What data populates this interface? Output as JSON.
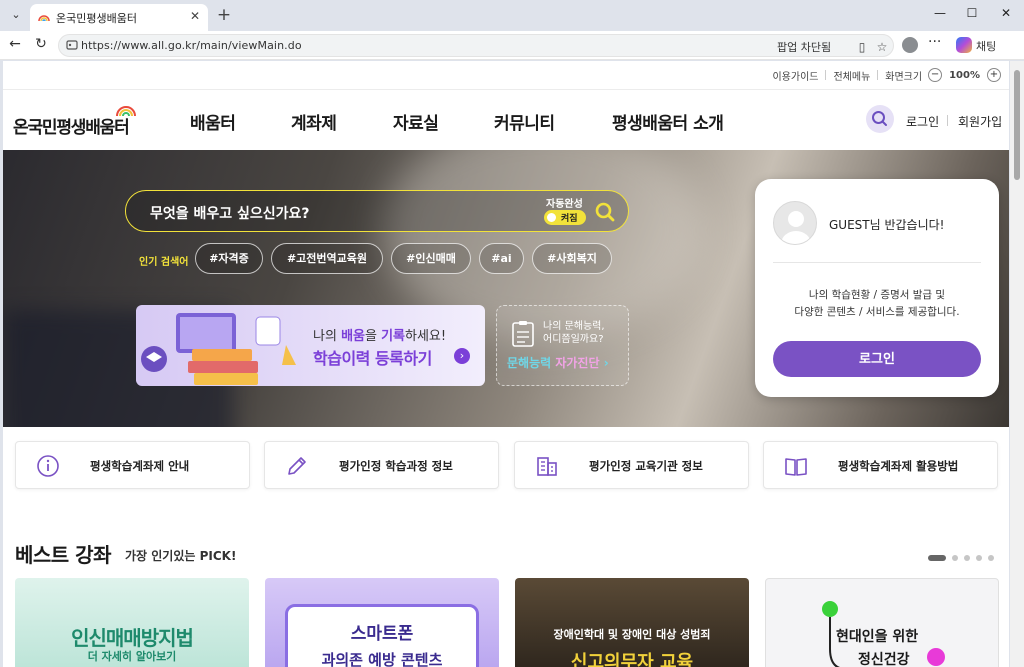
{
  "browser": {
    "tab_title": "온국민평생배움터",
    "url": "https://www.all.go.kr/main/viewMain.do",
    "popup_block": "팝업 차단됨",
    "chat_label": "채팅"
  },
  "util_menu": {
    "guide": "이용가이드",
    "all_menu": "전체메뉴",
    "screen_size": "화면크기",
    "zoom_minus": "−",
    "zoom_value": "100%",
    "zoom_plus": "+"
  },
  "header": {
    "logo": "온국민평생배움터",
    "nav": [
      "배움터",
      "계좌제",
      "자료실",
      "커뮤니티",
      "평생배움터 소개"
    ],
    "login": "로그인",
    "join": "회원가입"
  },
  "hero": {
    "search_placeholder": "무엇을 배우고 싶으신가요?",
    "auto_complete_label": "자동완성",
    "auto_complete_state": "켜짐",
    "popular_label": "인기 검색어",
    "popular_tags": [
      "#자격증",
      "#고전번역교육원",
      "#인신매매",
      "#ai",
      "#사회복지"
    ],
    "banner1_line1_pre": "나의 ",
    "banner1_line1_b1": "배움",
    "banner1_line1_mid": "을 ",
    "banner1_line1_b2": "기록",
    "banner1_line1_post": "하세요!",
    "banner1_line2": "학습이력 등록하기",
    "banner2_line1": "나의 문해능력,",
    "banner2_line2": "어디쯤일까요?",
    "banner2_line3_a": "문해능력 ",
    "banner2_line3_b": "자가진단"
  },
  "login_card": {
    "greeting": "GUEST님 반갑습니다!",
    "desc1": "나의 학습현황 / 증명서 발급 및",
    "desc2": "다양한 콘텐츠 / 서비스를 제공합니다.",
    "button": "로그인"
  },
  "quick_menu": [
    {
      "label": "평생학습계좌제 안내",
      "icon": "info-icon"
    },
    {
      "label": "평가인정 학습과정 정보",
      "icon": "pencil-icon"
    },
    {
      "label": "평가인정 교육기관 정보",
      "icon": "building-icon"
    },
    {
      "label": "평생학습계좌제 활용방법",
      "icon": "book-icon"
    }
  ],
  "best": {
    "title": "베스트 강좌",
    "subtitle": "가장 인기있는 PICK!",
    "cards": [
      {
        "line1": "인신매매방지법",
        "line2": "더 자세히 알아보기"
      },
      {
        "line1": "스마트폰",
        "line2": "과의존 예방 콘텐츠"
      },
      {
        "line1": "장애인학대 및 장애인 대상 성범죄",
        "line2": "신고의무자 교육"
      },
      {
        "line1": "현대인을 위한",
        "line2": "정신건강"
      }
    ]
  },
  "colors": {
    "accent_purple": "#7a52c4",
    "search_yellow": "#f2e23a"
  }
}
